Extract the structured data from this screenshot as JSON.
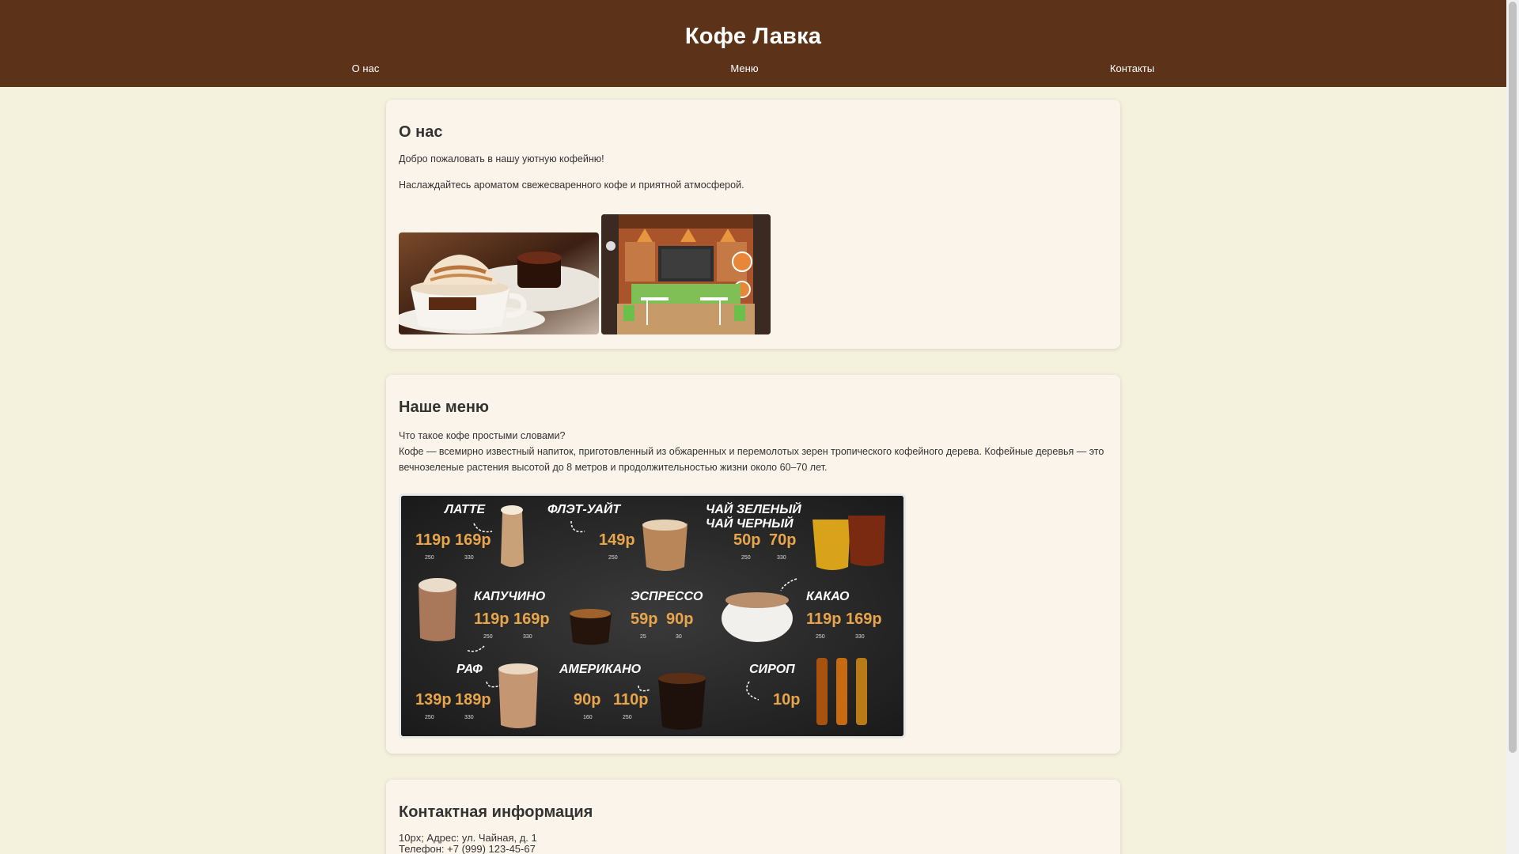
{
  "header": {
    "title": "Кофе Лавка",
    "nav": [
      "О нас",
      "Меню",
      "Контакты"
    ]
  },
  "about": {
    "heading": "О нас",
    "p1": "Добро пожаловать в нашу уютную кофейню!",
    "p2": "Наслаждайтесь ароматом свежесваренного кофе и приятной атмосферой."
  },
  "menu": {
    "heading": "Наше меню",
    "line1": "Что такое кофе простыми словами?",
    "line2": "Кофе — всемирно известный напиток, приготовленный из обжаренных и перемолотых зерен тропического кофейного дерева. Кофейные деревья — это вечнозеленые растения высотой до 8 метров и продолжительностью жизни около 60–70 лет.",
    "board": {
      "items": [
        {
          "name": "ЛАТТЕ",
          "prices": [
            "119р",
            "169р"
          ],
          "sizes": [
            "250",
            "330"
          ]
        },
        {
          "name": "ФЛЭТ-УАЙТ",
          "prices": [
            "149р"
          ],
          "sizes": [
            "250"
          ]
        },
        {
          "name": "ЧАЙ ЗЕЛЕНЫЙ",
          "name2": "ЧАЙ ЧЕРНЫЙ",
          "prices": [
            "50р",
            "70р"
          ],
          "sizes": [
            "250",
            "330"
          ]
        },
        {
          "name": "КАПУЧИНО",
          "prices": [
            "119р",
            "169р"
          ],
          "sizes": [
            "250",
            "330"
          ]
        },
        {
          "name": "ЭСПРЕССО",
          "prices": [
            "59р",
            "90р"
          ],
          "sizes": [
            "25",
            "30"
          ]
        },
        {
          "name": "КАКАО",
          "prices": [
            "119р",
            "169р"
          ],
          "sizes": [
            "250",
            "330"
          ]
        },
        {
          "name": "РАФ",
          "prices": [
            "139р",
            "189р"
          ],
          "sizes": [
            "250",
            "330"
          ]
        },
        {
          "name": "АМЕРИКАНО",
          "prices": [
            "90р",
            "110р"
          ],
          "sizes": [
            "160",
            "250"
          ]
        },
        {
          "name": "СИРОП",
          "prices": [
            "10р"
          ],
          "sizes": []
        }
      ]
    }
  },
  "contacts": {
    "heading": "Контактная информация",
    "address": "10px; Адрес: ул. Чайная, д. 1",
    "phone": "Телефон: +7 (999) 123-45-67"
  },
  "colors": {
    "header_bg": "#5c3319",
    "page_bg": "#f4f2dd",
    "card_bg": "#fbf4ea",
    "price": "#e8a54c"
  }
}
